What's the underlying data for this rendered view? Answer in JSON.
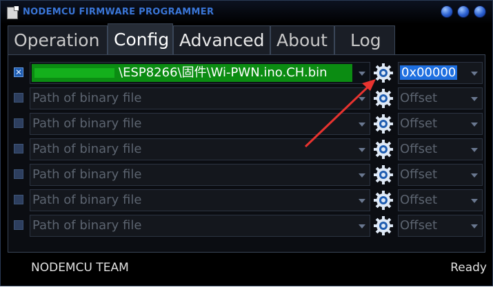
{
  "window": {
    "title": "NODEMCU FIRMWARE PROGRAMMER"
  },
  "tabs": [
    {
      "label": "Operation"
    },
    {
      "label": "Config"
    },
    {
      "label": "Advanced"
    },
    {
      "label": "About"
    },
    {
      "label": "Log"
    }
  ],
  "active_tab": "Config",
  "rows": [
    {
      "checked": true,
      "path": "\\ESP8266\\固件\\Wi-PWN.ino.CH.bin",
      "offset": "0x00000"
    },
    {
      "checked": false,
      "path": "Path of binary file",
      "offset": "Offset"
    },
    {
      "checked": false,
      "path": "Path of binary file",
      "offset": "Offset"
    },
    {
      "checked": false,
      "path": "Path of binary file",
      "offset": "Offset"
    },
    {
      "checked": false,
      "path": "Path of binary file",
      "offset": "Offset"
    },
    {
      "checked": false,
      "path": "Path of binary file",
      "offset": "Offset"
    },
    {
      "checked": false,
      "path": "Path of binary file",
      "offset": "Offset"
    }
  ],
  "checkbox_mark": "✕",
  "status": {
    "left": "NODEMCU TEAM",
    "right": "Ready"
  },
  "colors": {
    "accent": "#1e6fe0",
    "path_highlight": "#0b8c12",
    "annotation_arrow": "#e8332f"
  }
}
